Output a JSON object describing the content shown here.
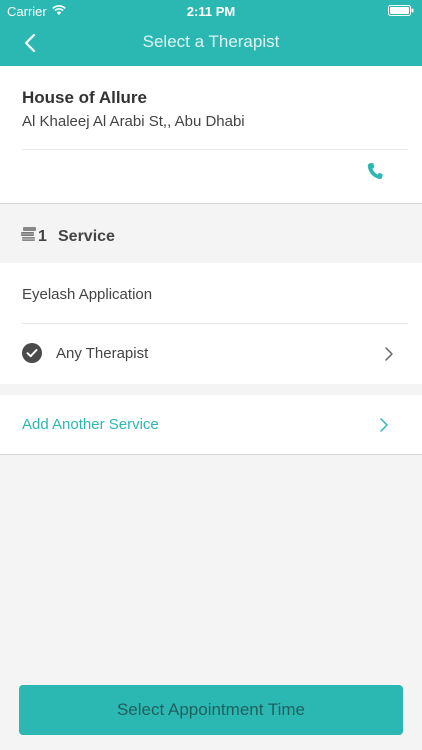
{
  "status_bar": {
    "carrier": "Carrier",
    "time": "2:11 PM"
  },
  "nav": {
    "title": "Select a Therapist",
    "back_icon": "chevron-left-icon"
  },
  "salon": {
    "name": "House of Allure",
    "address": "Al Khaleej Al Arabi St,, Abu Dhabi",
    "phone_icon": "phone-icon"
  },
  "services_section": {
    "count": "1",
    "label": "Service"
  },
  "service": {
    "name": "Eyelash Application",
    "therapist": "Any Therapist"
  },
  "add_service": {
    "label": "Add Another Service"
  },
  "cta": {
    "label": "Select Appointment Time"
  },
  "colors": {
    "accent": "#2bb8b3",
    "background": "#f4f4f4",
    "card": "#ffffff",
    "text": "#444444"
  }
}
